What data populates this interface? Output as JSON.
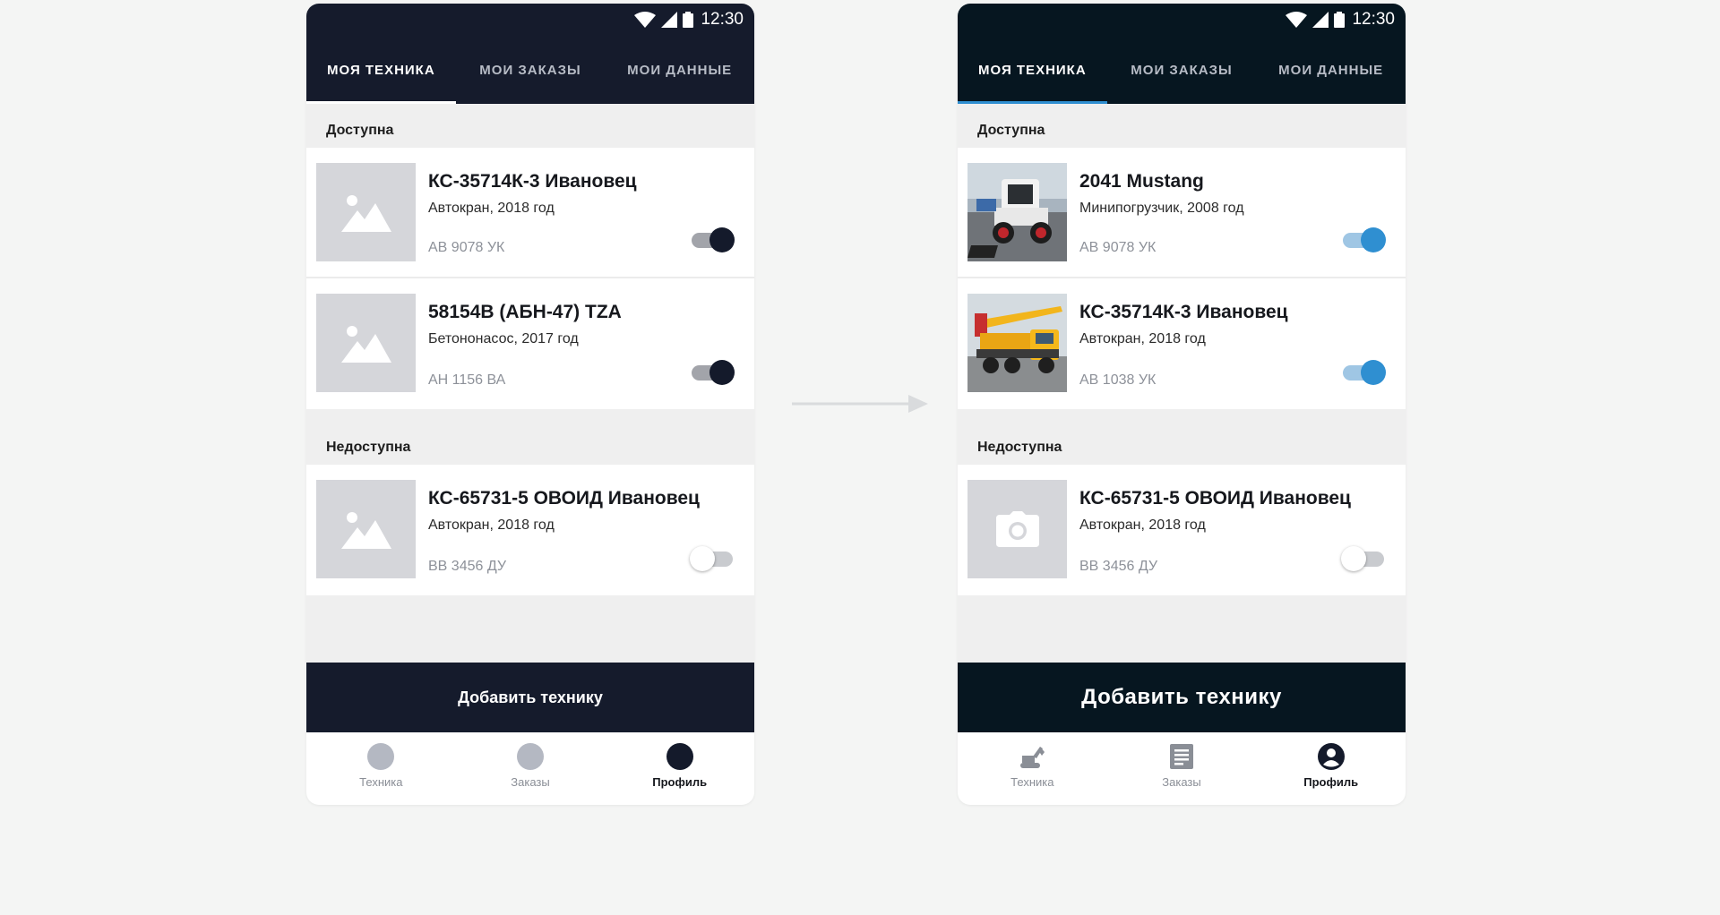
{
  "status_bar": {
    "time": "12:30"
  },
  "tabs": [
    "МОЯ ТЕХНИКА",
    "МОИ ЗАКАЗЫ",
    "МОИ ДАННЫЕ"
  ],
  "sections": {
    "available": "Доступна",
    "unavailable": "Недоступна"
  },
  "add_button": "Добавить технику",
  "bottom_nav": [
    "Техника",
    "Заказы",
    "Профиль"
  ],
  "left_screen": {
    "available_items": [
      {
        "title": "КС-35714К-3 Ивановец",
        "subtitle": "Автокран, 2018 год",
        "plate": "АВ 9078 УК",
        "enabled": true,
        "icon": "image-placeholder-icon"
      },
      {
        "title": "58154В (АБН-47) TZA",
        "subtitle": "Бетононасос, 2017 год",
        "plate": "АН 1156 ВА",
        "enabled": true,
        "icon": "image-placeholder-icon"
      }
    ],
    "unavailable_items": [
      {
        "title": "КС-65731-5 ОВОИД Ивановец",
        "subtitle": "Автокран, 2018 год",
        "plate": "ВВ 3456 ДУ",
        "enabled": false,
        "icon": "image-placeholder-icon"
      }
    ]
  },
  "right_screen": {
    "available_items": [
      {
        "title": "2041 Mustang",
        "subtitle": "Минипогрузчик, 2008 год",
        "plate": "АВ 9078 УК",
        "enabled": true,
        "icon": "skid-steer-photo"
      },
      {
        "title": "КС-35714К-3 Ивановец",
        "subtitle": "Автокран, 2018 год",
        "plate": "АВ 1038 УК",
        "enabled": true,
        "icon": "crane-truck-photo"
      }
    ],
    "unavailable_items": [
      {
        "title": "КС-65731-5 ОВОИД Ивановец",
        "subtitle": "Автокран, 2018 год",
        "plate": "ВВ 3456 ДУ",
        "enabled": false,
        "icon": "camera-icon"
      }
    ]
  },
  "colors": {
    "left_header": "#151b2c",
    "right_header": "#061620",
    "accent_blue": "#2f8fd1",
    "page_bg": "#f4f5f4"
  }
}
